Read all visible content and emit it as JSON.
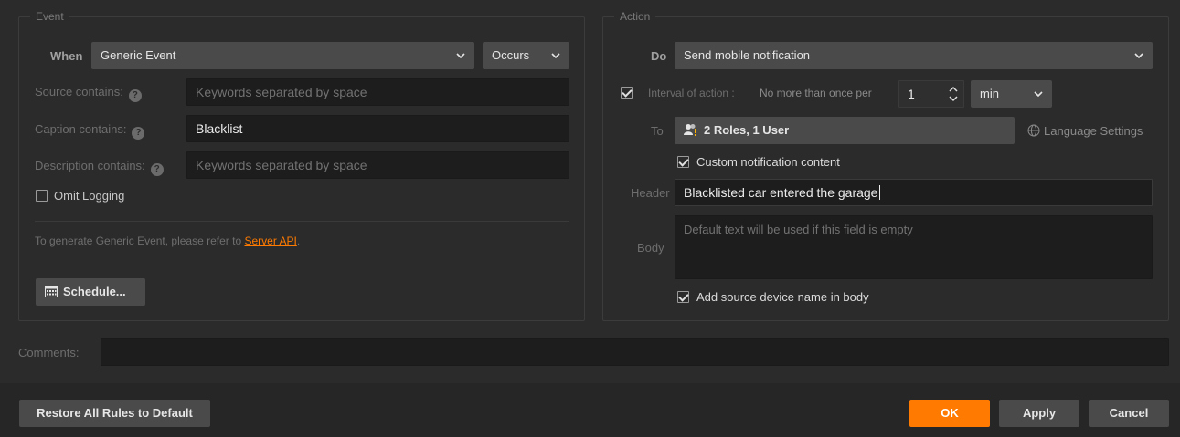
{
  "event": {
    "legend": "Event",
    "when_label": "When",
    "when_value": "Generic Event",
    "occurs_value": "Occurs",
    "source_label": "Source contains:",
    "source_placeholder": "Keywords separated by space",
    "caption_label": "Caption contains:",
    "caption_value": "Blacklist",
    "description_label": "Description contains:",
    "description_placeholder": "Keywords separated by space",
    "omit_logging_label": "Omit Logging",
    "omit_logging_checked": false,
    "info_text": "To generate Generic Event, please refer to ",
    "info_link": "Server API",
    "info_suffix": ".",
    "schedule_label": "Schedule..."
  },
  "action": {
    "legend": "Action",
    "do_label": "Do",
    "do_value": "Send mobile notification",
    "interval_checked": true,
    "interval_label": "Interval of action :",
    "interval_prefix": "No more than once per",
    "interval_value": "1",
    "interval_unit": "min",
    "to_label": "To",
    "to_value": "2 Roles, 1 User",
    "language_settings": "Language Settings",
    "custom_content_label": "Custom notification content",
    "custom_content_checked": true,
    "header_label": "Header",
    "header_value": "Blacklisted car entered the garage",
    "body_label": "Body",
    "body_placeholder": "Default text will be used if this field is empty",
    "add_source_label": "Add source device name in body",
    "add_source_checked": true
  },
  "comments": {
    "label": "Comments:",
    "value": ""
  },
  "footer": {
    "restore_label": "Restore All Rules to Default",
    "ok_label": "OK",
    "apply_label": "Apply",
    "cancel_label": "Cancel"
  },
  "colors": {
    "accent": "#ff7a00",
    "background": "#2b2b2b",
    "field": "#1d1d1d",
    "control": "#4a4a4a"
  }
}
